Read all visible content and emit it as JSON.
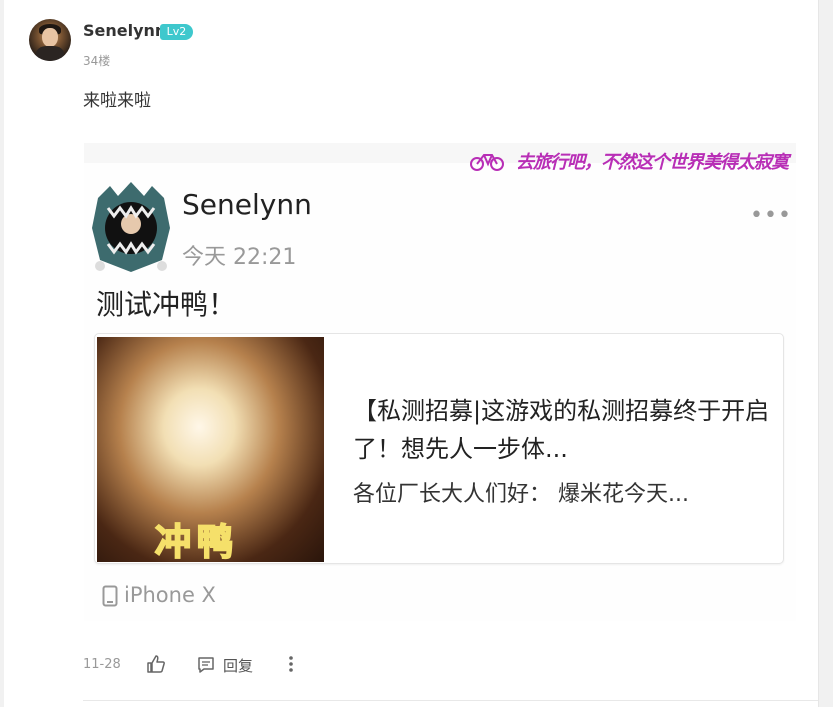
{
  "comment": {
    "username": "Senelynn",
    "level_badge": "Lv2",
    "floor": "34楼",
    "text": "来啦来啦"
  },
  "screenshot": {
    "slogan": "去旅行吧，不然这个世界美得太寂寞",
    "post": {
      "author": "Senelynn",
      "time": "今天 22:21",
      "text": "测试冲鸭！",
      "more_icon": "more-icon"
    },
    "share_card": {
      "thumb_text": "冲鸭",
      "title": "【私测招募|这游戏的私测招募终于开启了！想先人一步体...",
      "description": "各位厂长大人们好：  爆米花今天..."
    },
    "device": "iPhone X"
  },
  "footer": {
    "date": "11-28",
    "reply_label": "回复"
  },
  "colors": {
    "badge": "#3ec8cd",
    "slogan": "#b82eb6",
    "text": "#333333",
    "muted": "#999999"
  }
}
